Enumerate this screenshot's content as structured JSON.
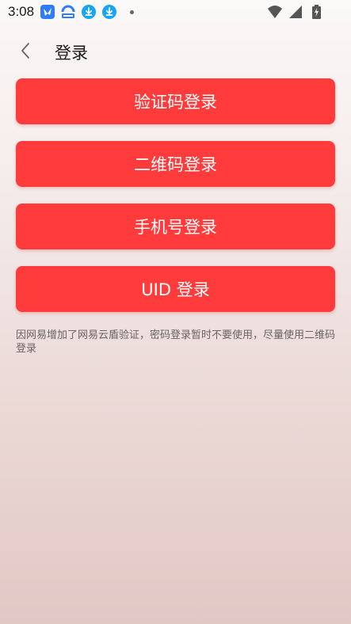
{
  "status_bar": {
    "time": "3:08",
    "icons_left": [
      "bird-app-icon",
      "baidu-netdisk-icon",
      "download-icon",
      "download-icon"
    ],
    "icons_right": [
      "wifi-icon",
      "cell-signal-icon",
      "battery-charging-icon"
    ]
  },
  "header": {
    "title": "登录",
    "back_icon": "chevron-left-icon"
  },
  "login_options": [
    {
      "label": "验证码登录"
    },
    {
      "label": "二维码登录"
    },
    {
      "label": "手机号登录"
    },
    {
      "label": "UID 登录"
    }
  ],
  "hint": "因网易增加了网易云盾验证，密码登录暂时不要使用，尽量使用二维码登录",
  "colors": {
    "button": "#ff3b3b",
    "button_text": "#ffffff",
    "hint_text": "#6b6262"
  }
}
